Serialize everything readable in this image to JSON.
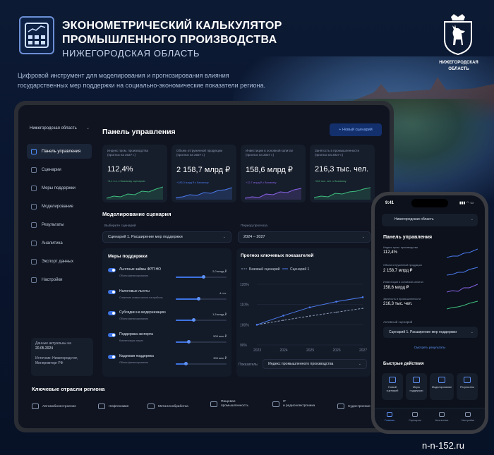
{
  "header": {
    "title_line1": "ЭКОНОМЕТРИЧЕСКИЙ КАЛЬКУЛЯТОР",
    "title_line2": "ПРОМЫШЛЕННОГО ПРОИЗВОДСТВА",
    "subtitle": "НИЖЕГОРОДСКАЯ ОБЛАСТЬ",
    "desc_line1": "Цифровой инструмент для моделирования и прогнозирования влияния",
    "desc_line2": "государственных мер поддержки на социально-экономические показатели региона.",
    "app_icon": "calculator-icon",
    "emblem_caption_line1": "НИЖЕГОРОДСКАЯ",
    "emblem_caption_line2": "ОБЛАСТЬ",
    "emblem_icon": "deer-coat-of-arms-icon"
  },
  "tablet": {
    "region": "Нижегородская область",
    "nav": [
      {
        "label": "Панель управления",
        "icon": "grid-icon",
        "active": true
      },
      {
        "label": "Сценарии",
        "icon": "file-icon",
        "active": false
      },
      {
        "label": "Меры поддержки",
        "icon": "layers-icon",
        "active": false
      },
      {
        "label": "Моделирование",
        "icon": "sliders-icon",
        "active": false
      },
      {
        "label": "Результаты",
        "icon": "chart-icon",
        "active": false
      },
      {
        "label": "Аналитика",
        "icon": "pie-icon",
        "active": false
      },
      {
        "label": "Экспорт данных",
        "icon": "download-icon",
        "active": false
      },
      {
        "label": "Настройки",
        "icon": "gear-icon",
        "active": false
      }
    ],
    "info": {
      "line1": "Данные актуальны на",
      "line2": "20.05.2024",
      "line3": "Источник: Нижегородстат,",
      "line4": "Минпромторг РФ"
    },
    "title": "Панель управления",
    "new_button": "+ Новый сценарий",
    "kpis": [
      {
        "label1": "Индекс пром. производства",
        "label2": "(прогноз на 2027 г.)",
        "value": "112,4%",
        "delta": "+4,1 п.п. к базовому сценарию",
        "color": "#3fbf7f"
      },
      {
        "label1": "Объем отгруженной продукции",
        "label2": "(прогноз на 2027 г.)",
        "value": "2 158,7 млрд ₽",
        "delta": "+185,3 млрд ₽ к базовому",
        "color": "#4b7bf0"
      },
      {
        "label1": "Инвестиции в основной капитал",
        "label2": "(прогноз на 2027 г.)",
        "value": "158,6 млрд ₽",
        "delta": "+12,7 млрд ₽ к базовому",
        "color": "#8a63e8"
      },
      {
        "label1": "Занятость в промышленности",
        "label2": "(прогноз на 2027 г.)",
        "value": "216,3 тыс. чел.",
        "delta": "+8,6 тыс. чел. к базовому",
        "color": "#3fbf7f"
      }
    ],
    "modeling": {
      "title": "Моделирование сценария",
      "scenario_label": "Выберите сценарий",
      "scenario_value": "Сценарий 1. Расширение мер поддержки",
      "period_label": "Период прогноза",
      "period_value": "2024 – 2027"
    },
    "measures": {
      "title": "Меры поддержки",
      "items": [
        {
          "name": "Льготные займы ФРП НО",
          "hint": "Объем финансирования",
          "value": "2,0 млрд ₽",
          "on": true,
          "level": 0.55
        },
        {
          "name": "Налоговые льготы",
          "hint": "Снижение ставки налога на прибыль",
          "value": "4 п.п.",
          "on": true,
          "level": 0.45
        },
        {
          "name": "Субсидии на модернизацию",
          "hint": "Объем финансирования",
          "value": "1,5 млрд ₽",
          "on": true,
          "level": 0.35
        },
        {
          "name": "Поддержка экспорта",
          "hint": "Компенсация затрат",
          "value": "500 млн ₽",
          "on": true,
          "level": 0.25
        },
        {
          "name": "Кадровая поддержка",
          "hint": "Объем финансирования",
          "value": "300 млн ₽",
          "on": true,
          "level": 0.2
        }
      ]
    },
    "forecast": {
      "title": "Прогноз ключевых показателей",
      "indicator_label": "Показатель:",
      "indicator_value": "Индекс промышленного производства"
    },
    "sectors": {
      "title": "Ключевые отрасли региона",
      "items": [
        {
          "label": "Автомобилестроение",
          "icon": "car-icon"
        },
        {
          "label": "Нефтехимия",
          "icon": "factory-icon"
        },
        {
          "label": "Металлообработка",
          "icon": "wrench-icon"
        },
        {
          "label1": "Пищевая",
          "label2": "промышленность",
          "icon": "food-icon"
        },
        {
          "label1": "IT",
          "label2": "и радиоэлектроника",
          "icon": "monitor-icon"
        },
        {
          "label": "Судостроение",
          "icon": "ship-icon"
        }
      ]
    }
  },
  "chart_data": {
    "type": "line",
    "title": "Прогноз ключевых показателей",
    "x": [
      "2023",
      "2024",
      "2025",
      "2026",
      "2027"
    ],
    "ylim": [
      90,
      120
    ],
    "yticks": [
      "120%",
      "110%",
      "100%",
      "90%"
    ],
    "series": [
      {
        "name": "Базовый сценарий",
        "values": [
          100.0,
          102.2,
          104.3,
          106.2,
          108.1
        ],
        "color": "#8da0bf",
        "dash": true
      },
      {
        "name": "Сценарий 1",
        "values": [
          100.0,
          104.5,
          108.6,
          111.4,
          113.6
        ],
        "color": "#4b7bf0",
        "dash": false
      }
    ],
    "legend": "top",
    "grid": true
  },
  "phone": {
    "time": "9:41",
    "status": "▮▮▮ ◠ ▭",
    "region": "Нижегородская область",
    "title": "Панель управления",
    "kpis": [
      {
        "label": "Индекс пром. производства",
        "value": "112,4%",
        "color": "#4b7bf0"
      },
      {
        "label": "Объем отгруженной продукции",
        "value": "2 158,7 млрд ₽",
        "color": "#4b7bf0"
      },
      {
        "label": "Инвестиции в основной капитал",
        "value": "158,6 млрд ₽",
        "color": "#8a63e8"
      },
      {
        "label": "Занятость в промышленности",
        "value": "216,3 тыс. чел.",
        "color": "#3fbf7f"
      }
    ],
    "active_label": "Активный сценарий",
    "active_value": "Сценарий 1. Расширение мер поддержки",
    "results_link": "Смотреть результаты",
    "quick_title": "Быстрые действия",
    "quick": [
      {
        "label1": "Новый",
        "label2": "сценарий",
        "icon": "plus-file-icon"
      },
      {
        "label1": "Меры",
        "label2": "поддержки",
        "icon": "layers-icon"
      },
      {
        "label1": "Моделирование",
        "label2": "",
        "icon": "sliders-icon"
      },
      {
        "label1": "Результаты",
        "label2": "",
        "icon": "chart-icon"
      }
    ],
    "tabs": [
      {
        "label": "Главная",
        "active": true
      },
      {
        "label": "Сценарии",
        "active": false
      },
      {
        "label": "Аналитика",
        "active": false
      },
      {
        "label": "Настройки",
        "active": false
      }
    ]
  },
  "watermark": "n-n-152.ru"
}
